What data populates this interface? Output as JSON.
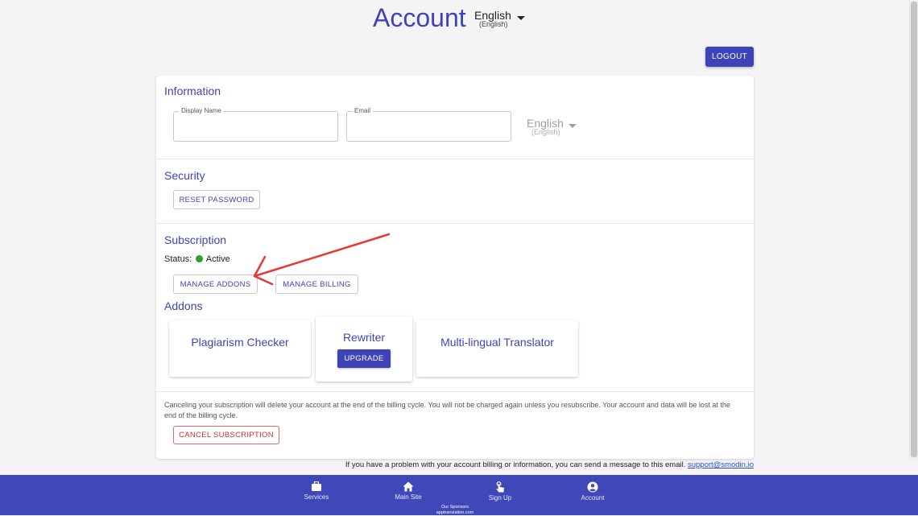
{
  "header": {
    "title": "Account",
    "language": {
      "main": "English",
      "sub": "(English)"
    }
  },
  "logout_label": "LOGOUT",
  "information": {
    "title": "Information",
    "display_name_label": "Display Name",
    "display_name_value": "",
    "email_label": "Email",
    "email_value": "",
    "language": {
      "main": "English",
      "sub": "(English)"
    }
  },
  "security": {
    "title": "Security",
    "reset_password_label": "RESET PASSWORD"
  },
  "subscription": {
    "title": "Subscription",
    "status_label": "Status:",
    "status_value": "Active",
    "status_color": "#2a9d2a",
    "manage_addons_label": "MANAGE ADDONS",
    "manage_billing_label": "MANAGE BILLING"
  },
  "addons": {
    "title": "Addons",
    "items": [
      {
        "name": "Plagiarism Checker"
      },
      {
        "name": "Rewriter",
        "action_label": "UPGRADE"
      },
      {
        "name": "Multi-lingual Translator"
      }
    ]
  },
  "cancel": {
    "note": "Canceling your subscription will delete your account at the end of the billing cycle. You will not be charged again unless you resubscribe. Your account and data will be lost at the end of the billing cycle.",
    "button_label": "CANCEL SUBSCRIPTION"
  },
  "support": {
    "text": "If you have a problem with your account billing or information, you can send a message to this email.",
    "email": "support@smodin.io"
  },
  "footer": {
    "nav": [
      {
        "label": "Services",
        "icon": "briefcase-icon"
      },
      {
        "label": "Main Site",
        "icon": "home-icon"
      },
      {
        "label": "Sign Up",
        "icon": "touch-icon"
      },
      {
        "label": "Account",
        "icon": "account-circle-icon"
      }
    ],
    "sponsors_title": "Our Sponsors",
    "sponsor": "apptranslation.com"
  },
  "colors": {
    "primary": "#3f43b8",
    "footer": "#3f48b8",
    "danger": "#d32f2f",
    "annotation_arrow": "#e53935"
  }
}
